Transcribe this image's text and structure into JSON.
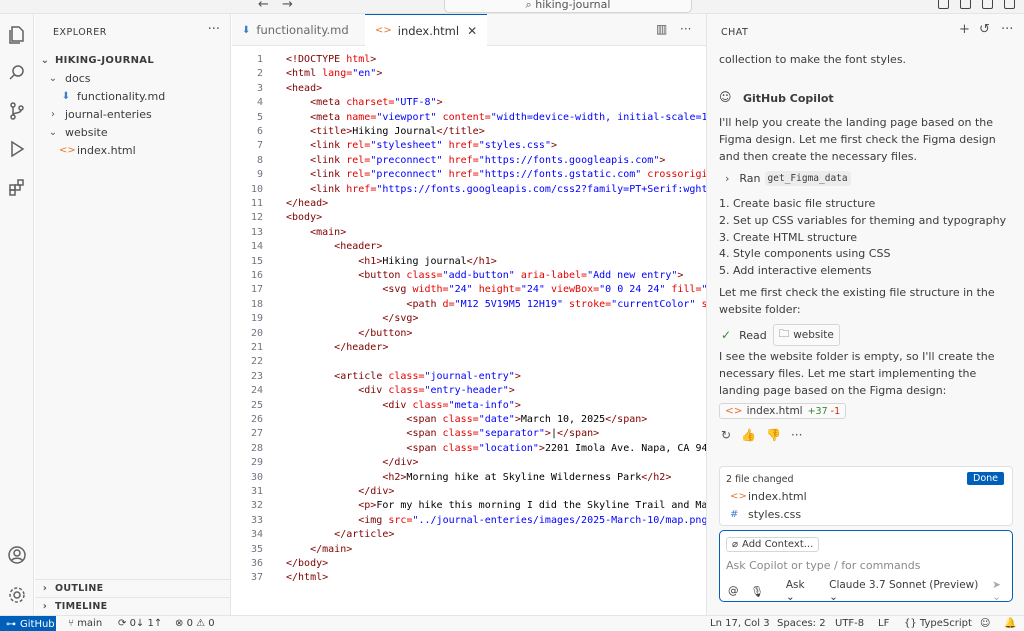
{
  "titlebar": {
    "back_icon": "arrow-left-icon",
    "forward_icon": "arrow-right-icon",
    "search_text": "hiking-journal"
  },
  "explorer": {
    "title": "EXPLORER",
    "root": "HIKING-JOURNAL",
    "tree": [
      {
        "label": "docs",
        "type": "folder",
        "open": true,
        "depth": 1
      },
      {
        "label": "functionality.md",
        "type": "md",
        "depth": 2
      },
      {
        "label": "journal-enteries",
        "type": "folder",
        "open": false,
        "depth": 1
      },
      {
        "label": "website",
        "type": "folder",
        "open": true,
        "depth": 1
      },
      {
        "label": "index.html",
        "type": "html",
        "depth": 2
      }
    ],
    "outline": "OUTLINE",
    "timeline": "TIMELINE"
  },
  "editor": {
    "tabs": [
      {
        "label": "functionality.md",
        "active": false
      },
      {
        "label": "index.html",
        "active": true
      }
    ],
    "lines": [
      "<!DOCTYPE html>",
      "<html lang=\"en\">",
      "<head>",
      "    <meta charset=\"UTF-8\">",
      "    <meta name=\"viewport\" content=\"width=device-width, initial-scale=1.0",
      "    <title>Hiking Journal</title>",
      "    <link rel=\"stylesheet\" href=\"styles.css\">",
      "    <link rel=\"preconnect\" href=\"https://fonts.googleapis.com\">",
      "    <link rel=\"preconnect\" href=\"https://fonts.gstatic.com\" crossorigin",
      "    <link href=\"https://fonts.googleapis.com/css2?family=PT+Serif:wght@",
      "</head>",
      "<body>",
      "    <main>",
      "        <header>",
      "            <h1>Hiking journal</h1>",
      "            <button class=\"add-button\" aria-label=\"Add new entry\">",
      "                <svg width=\"24\" height=\"24\" viewBox=\"0 0 24 24\" fill=\"no",
      "                    <path d=\"M12 5V19M5 12H19\" stroke=\"currentColor\" st",
      "                </svg>",
      "            </button>",
      "        </header>",
      "",
      "        <article class=\"journal-entry\">",
      "            <div class=\"entry-header\">",
      "                <div class=\"meta-info\">",
      "                    <span class=\"date\">March 10, 2025</span>",
      "                    <span class=\"separator\">|</span>",
      "                    <span class=\"location\">2201 Imola Ave. Napa, CA 9455",
      "                </div>",
      "                <h2>Morning hike at Skyline Wilderness Park</h2>",
      "            </div>",
      "            <p>For my hike this morning I did the Skyline Trail and Mani",
      "            <img src=\"../journal-enteries/images/2025-March-10/map.png\"",
      "        </article>",
      "    </main>",
      "</body>",
      "</html>"
    ]
  },
  "chat": {
    "title": "CHAT",
    "intro_tail": "collection to make the font styles.",
    "assistant_name": "GitHub Copilot",
    "msg1": "I'll help you create the landing page based on the Figma design. Let me first check the Figma design and then create the necessary files.",
    "ran_label": "Ran",
    "ran_tool": "get_Figma_data",
    "steps": [
      "1. Create basic file structure",
      "2. Set up CSS variables for theming and typography",
      "3. Create HTML structure",
      "4. Style components using CSS",
      "5. Add interactive elements"
    ],
    "msg2": "Let me first check the existing file structure in the website folder:",
    "read_label": "Read",
    "read_target": "website",
    "msg3": "I see the website folder is empty, so I'll create the necessary files. Let me start implementing the landing page based on the Figma design:",
    "edit_file": "index.html",
    "edit_added": "+37",
    "edit_removed": "-1",
    "changed_header": "2 file changed",
    "done_label": "Done",
    "changed_files": [
      "index.html",
      "styles.css"
    ],
    "add_context": "Add Context...",
    "input_placeholder": "Ask Copilot or type / for commands",
    "mode": "Ask",
    "model": "Claude 3.7 Sonnet (Preview)"
  },
  "status": {
    "remote": "GitHub",
    "branch": "main",
    "sync": "0↓ 1↑",
    "problems": "0",
    "warnings": "0",
    "position": "Ln 17, Col 3",
    "spaces": "Spaces: 2",
    "encoding": "UTF-8",
    "eol": "LF",
    "language": "TypeScript"
  },
  "colors": {
    "accent": "#005fb8",
    "tag": "#800000",
    "attr": "#e50000",
    "value": "#0000ff"
  }
}
